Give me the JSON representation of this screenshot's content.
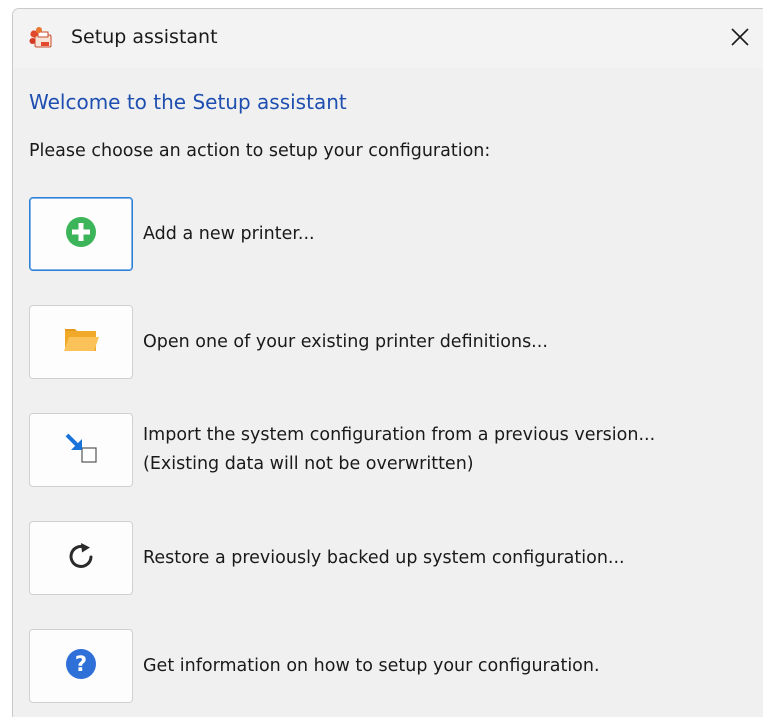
{
  "window": {
    "title": "Setup assistant",
    "app_icon": "printer-app-icon",
    "close_icon": "close-icon"
  },
  "content": {
    "welcome_heading": "Welcome to the Setup assistant",
    "instruction": "Please choose an action to setup your configuration:"
  },
  "actions": [
    {
      "icon": "add-circle-icon",
      "label": "Add a new printer...",
      "subtext": ""
    },
    {
      "icon": "folder-open-icon",
      "label": "Open one of your existing printer definitions...",
      "subtext": ""
    },
    {
      "icon": "import-icon",
      "label": "Import the system configuration from a previous version...",
      "subtext": "(Existing data will not be overwritten)"
    },
    {
      "icon": "restore-icon",
      "label": "Restore a previously backed up system configuration...",
      "subtext": ""
    },
    {
      "icon": "help-icon",
      "label": "Get information on how to setup your configuration.",
      "subtext": ""
    }
  ],
  "colors": {
    "heading_blue": "#1e4fb0",
    "add_green": "#3cb55a",
    "folder_orange": "#f5a623",
    "import_blue": "#1a73d9",
    "help_blue": "#2f6fd8",
    "focus_border": "#2c7fd6"
  }
}
